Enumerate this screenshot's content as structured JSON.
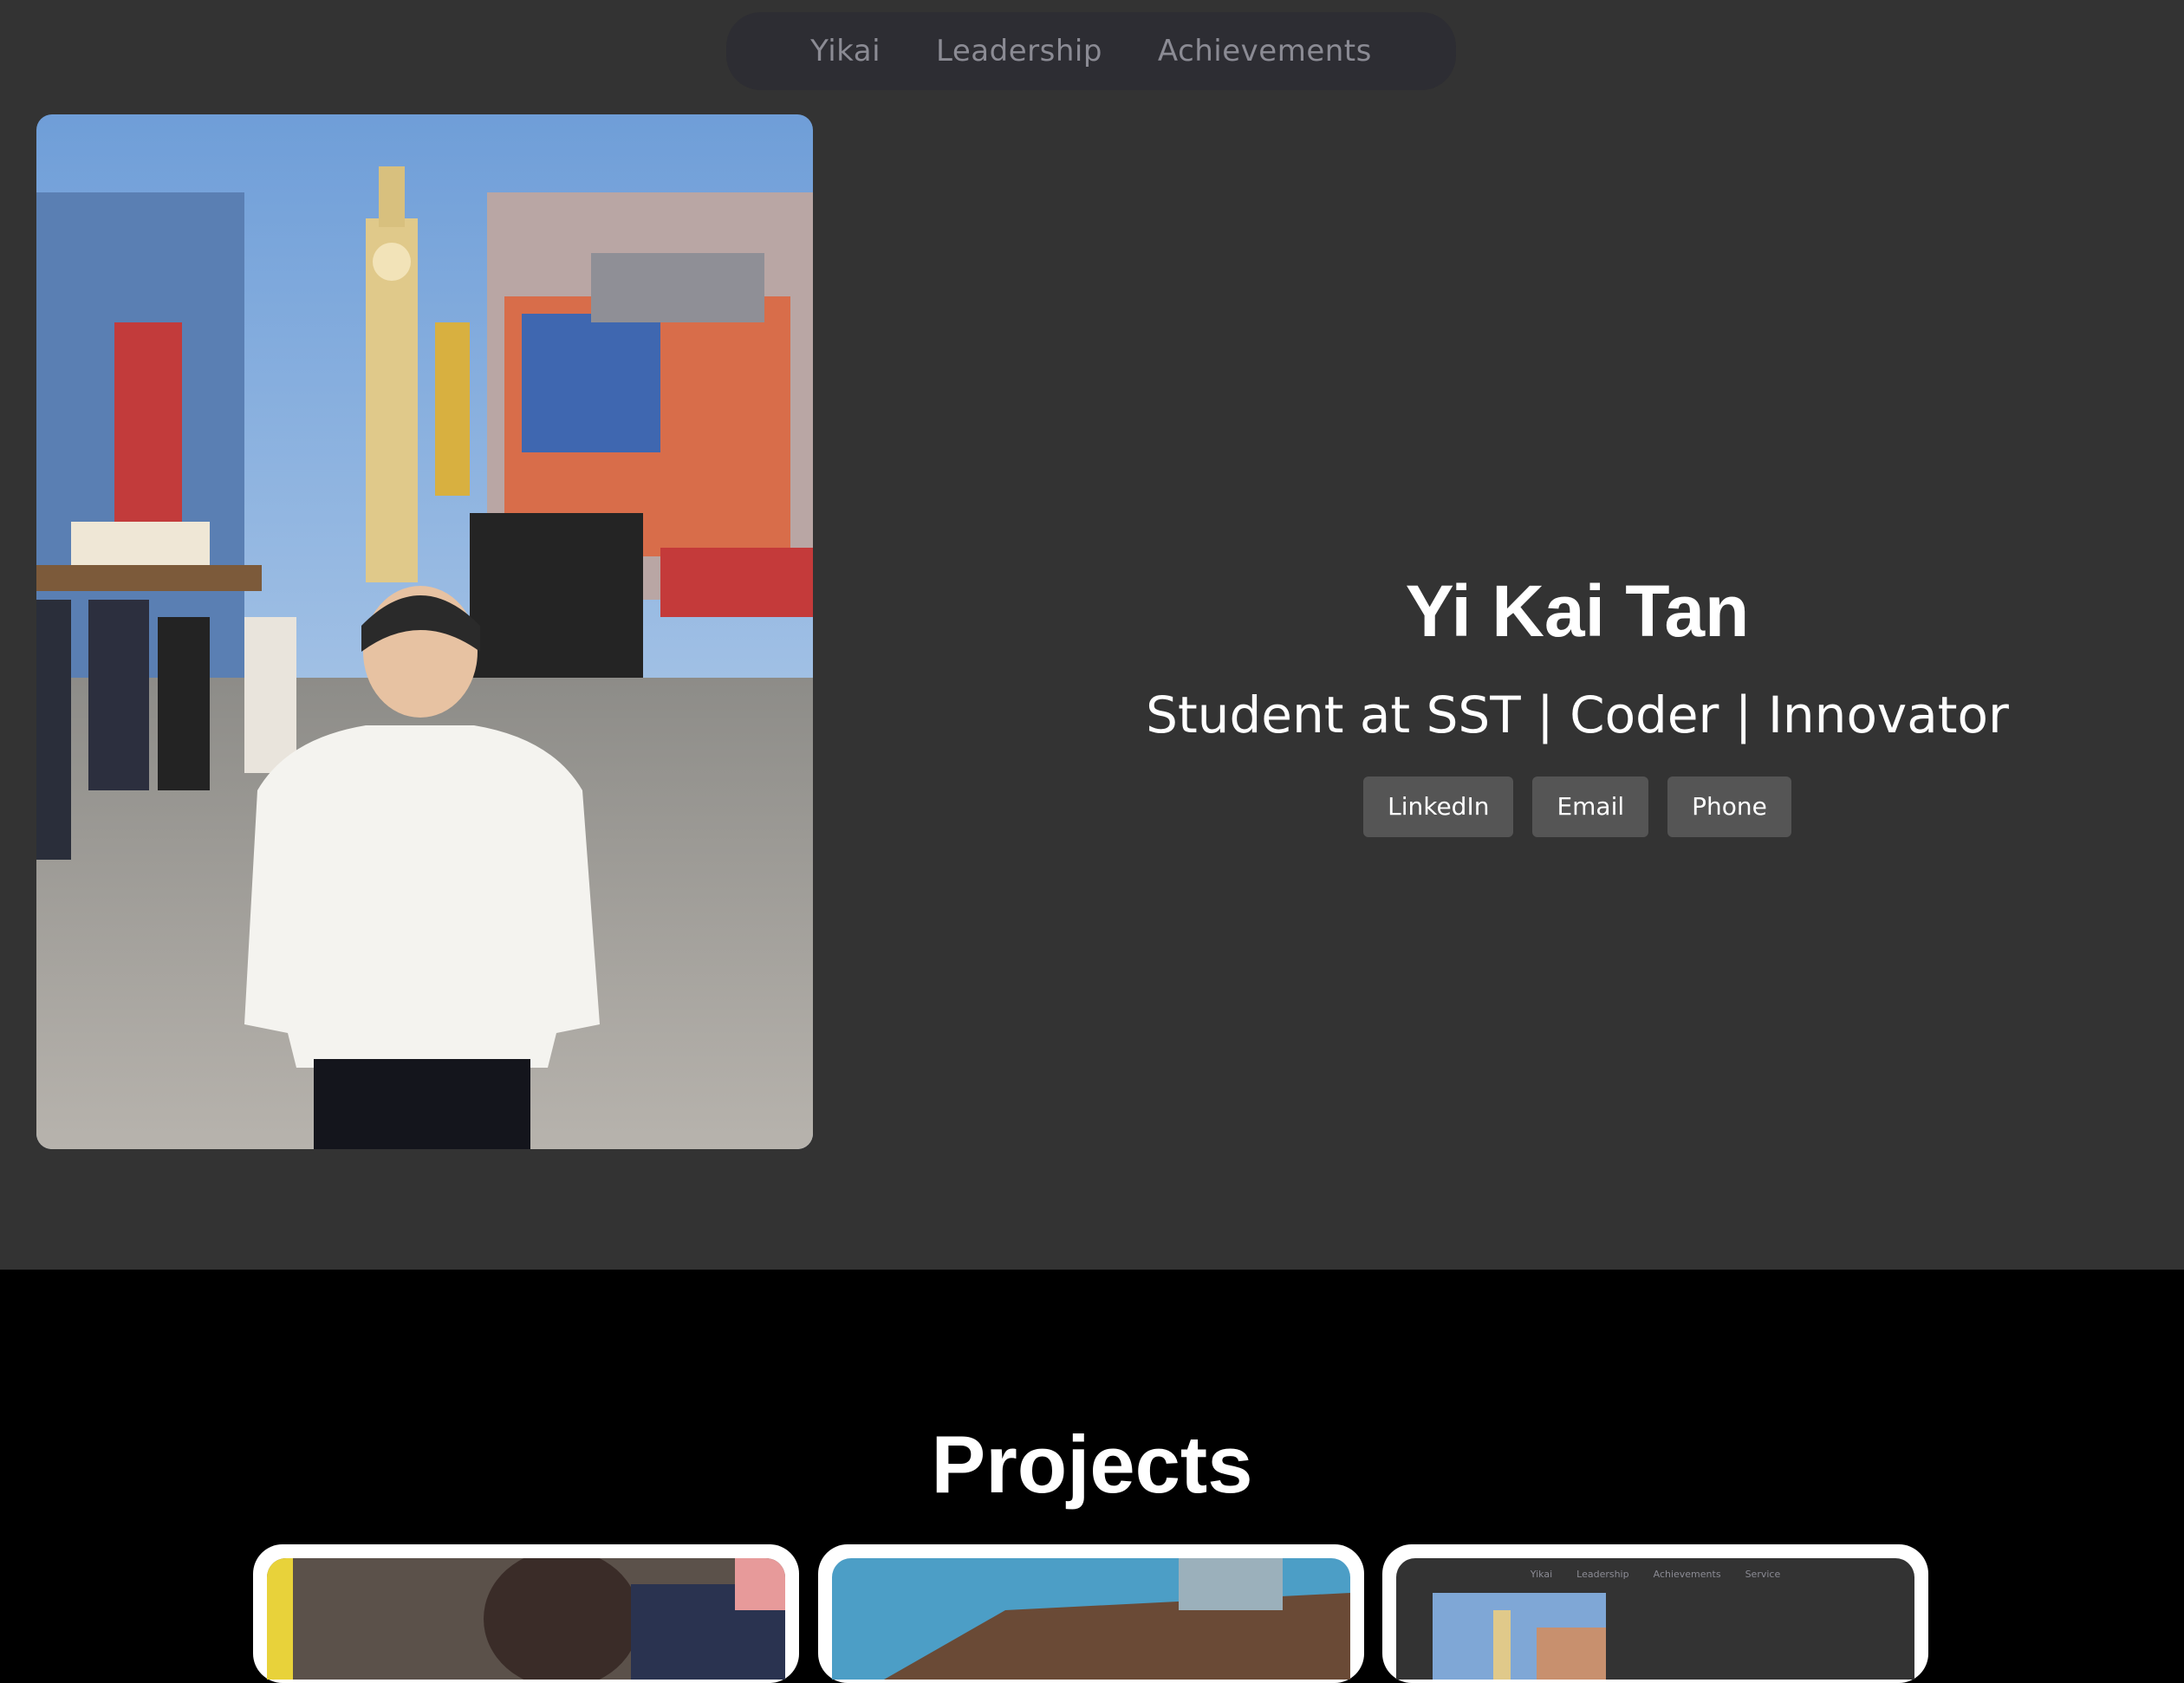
{
  "nav": {
    "items": [
      {
        "label": "Yikai"
      },
      {
        "label": "Leadership"
      },
      {
        "label": "Achievements"
      }
    ]
  },
  "hero": {
    "name": "Yi Kai Tan",
    "tagline": "Student at SST | Coder | Innovator",
    "buttons": [
      {
        "label": "LinkedIn"
      },
      {
        "label": "Email"
      },
      {
        "label": "Phone"
      }
    ]
  },
  "projects": {
    "title": "Projects",
    "card3_mini_nav": [
      "Yikai",
      "Leadership",
      "Achievements",
      "Service"
    ]
  },
  "colors": {
    "hero_bg": "#333333",
    "nav_bg": "#2d2d33",
    "button_bg": "#555555",
    "page_bg": "#000000"
  }
}
